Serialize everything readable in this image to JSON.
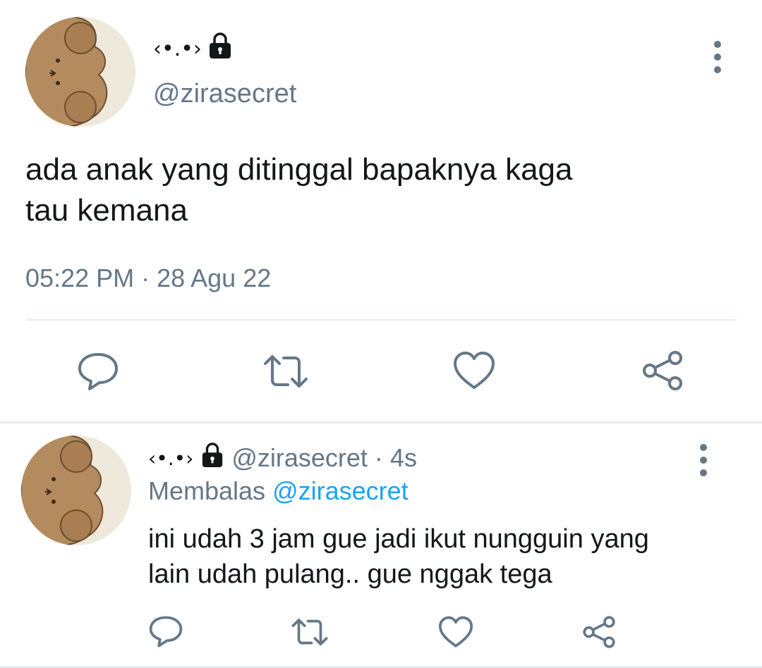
{
  "colors": {
    "text_primary": "#14171a",
    "text_secondary": "#657786",
    "link": "#1da1f2",
    "divider": "#e6ecf0"
  },
  "main_tweet": {
    "display_name": "‹•.•›",
    "locked_icon": "lock-icon",
    "handle": "@zirasecret",
    "text_line1": "ada anak yang ditinggal bapaknya kaga",
    "text_line2": "tau kemana",
    "timestamp": "05:22 PM · 28 Agu 22",
    "actions": [
      "reply-icon",
      "retweet-icon",
      "like-icon",
      "share-icon"
    ]
  },
  "reply_tweet": {
    "display_name": "‹•.•›",
    "locked_icon": "lock-icon",
    "handle": "@zirasecret",
    "separator": "·",
    "time_ago": "4s",
    "replying_label": "Membalas",
    "replying_to": "@zirasecret",
    "text_line1": "ini udah 3 jam gue jadi ikut nungguin yang",
    "text_line2": "lain udah pulang.. gue nggak tega",
    "actions": [
      "reply-icon",
      "retweet-icon",
      "like-icon",
      "share-icon"
    ]
  }
}
